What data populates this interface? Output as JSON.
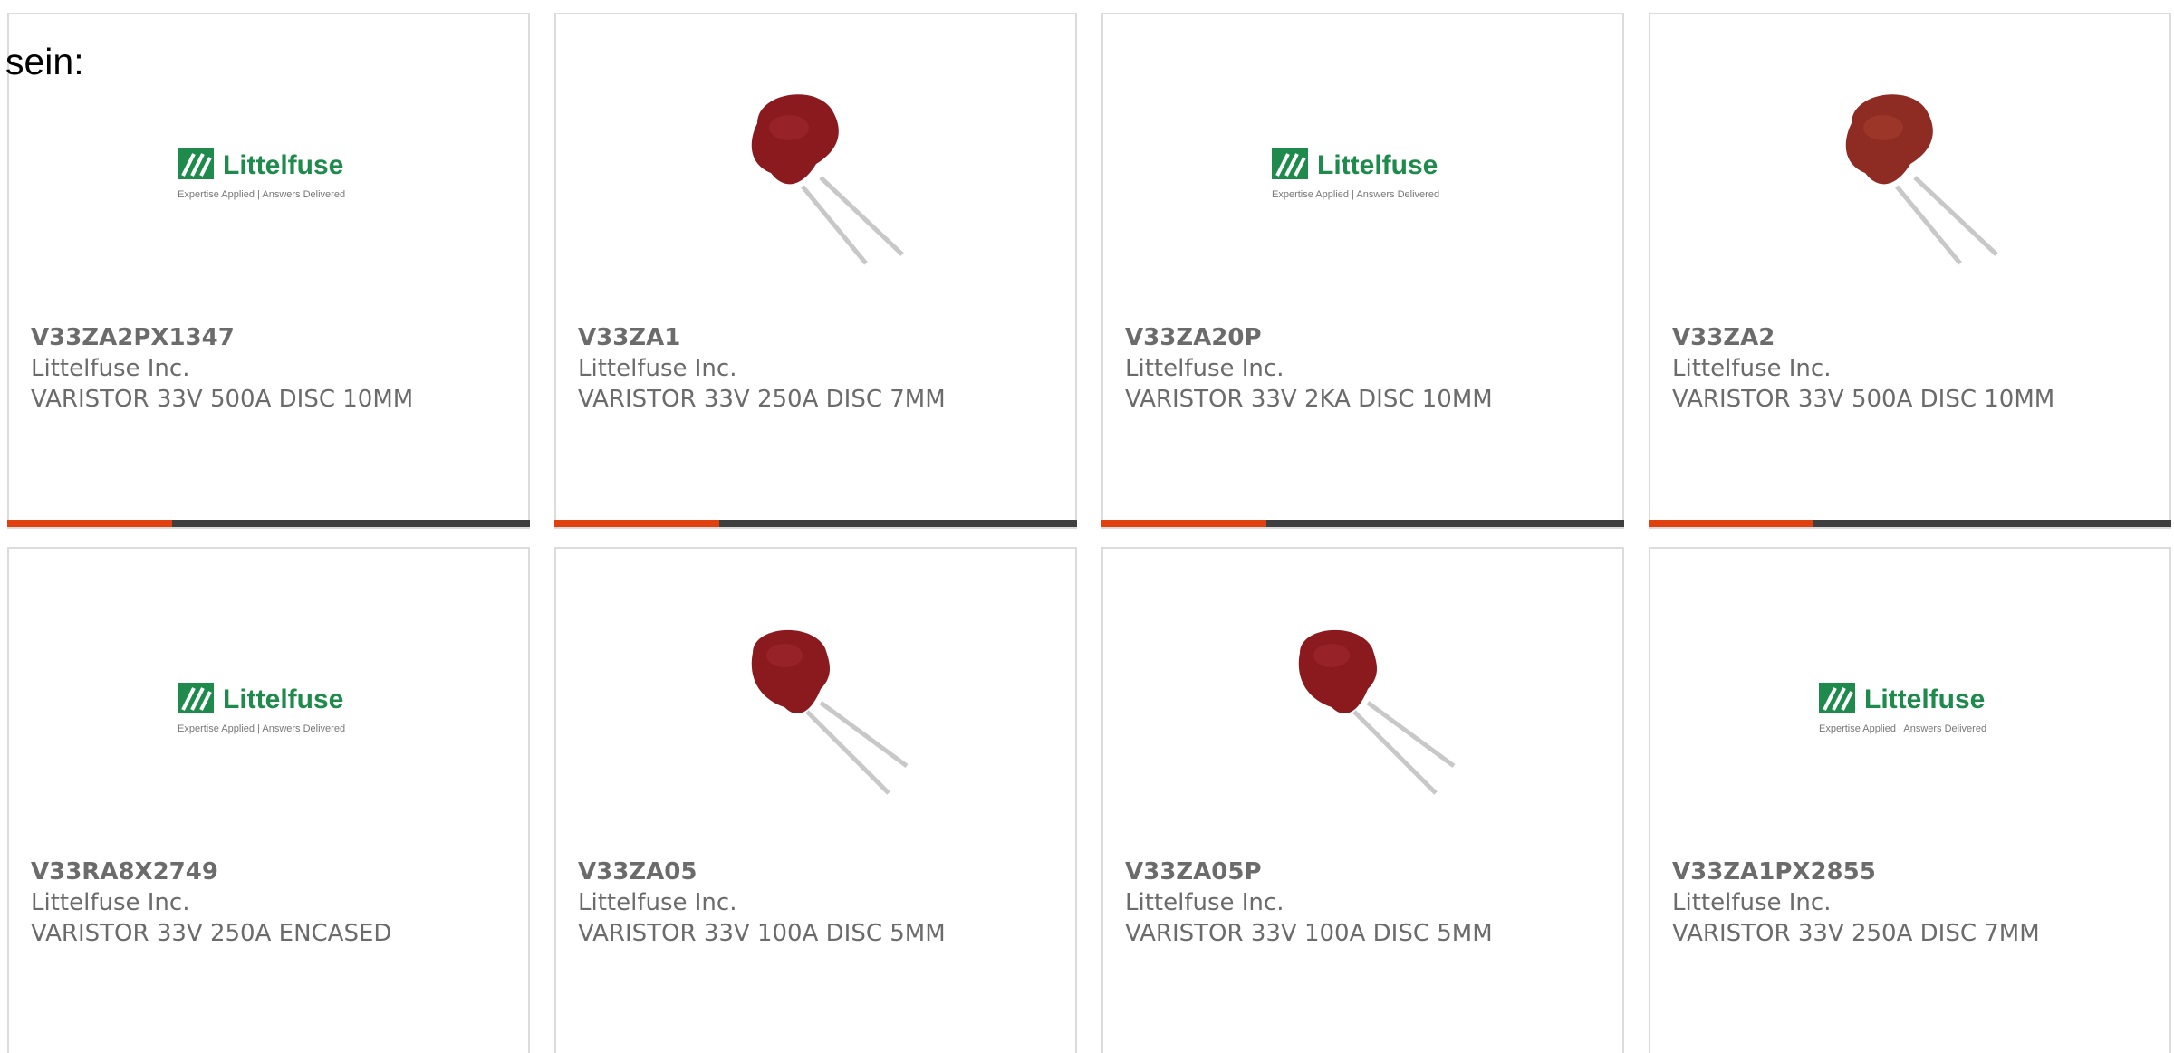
{
  "page": {
    "lead_text": "sein:"
  },
  "brand": {
    "logo_name": "Littelfuse",
    "logo_tagline": "Expertise Applied | Answers Delivered",
    "colors": {
      "logo_green": "#1e8a4c",
      "accent_orange": "#e0410f",
      "bar_dark": "#3f3f3f",
      "card_border": "#dcdcdc",
      "text_gray": "#6b6b6b",
      "varistor_red": "#8b1a1f"
    }
  },
  "products": [
    {
      "part_number": "V33ZA2PX1347",
      "manufacturer": "Littelfuse Inc.",
      "description": "VARISTOR 33V 500A DISC 10MM",
      "image": "logo"
    },
    {
      "part_number": "V33ZA1",
      "manufacturer": "Littelfuse Inc.",
      "description": "VARISTOR 33V 250A DISC 7MM",
      "image": "varistor-photo"
    },
    {
      "part_number": "V33ZA20P",
      "manufacturer": "Littelfuse Inc.",
      "description": "VARISTOR 33V 2KA DISC 10MM",
      "image": "logo"
    },
    {
      "part_number": "V33ZA2",
      "manufacturer": "Littelfuse Inc.",
      "description": "VARISTOR 33V 500A DISC 10MM",
      "image": "varistor-photo"
    },
    {
      "part_number": "V33RA8X2749",
      "manufacturer": "Littelfuse Inc.",
      "description": "VARISTOR 33V 250A ENCASED",
      "image": "logo"
    },
    {
      "part_number": "V33ZA05",
      "manufacturer": "Littelfuse Inc.",
      "description": "VARISTOR 33V 100A DISC 5MM",
      "image": "varistor-photo"
    },
    {
      "part_number": "V33ZA05P",
      "manufacturer": "Littelfuse Inc.",
      "description": "VARISTOR 33V 100A DISC 5MM",
      "image": "varistor-photo"
    },
    {
      "part_number": "V33ZA1PX2855",
      "manufacturer": "Littelfuse Inc.",
      "description": "VARISTOR 33V 250A DISC 7MM",
      "image": "logo"
    }
  ]
}
